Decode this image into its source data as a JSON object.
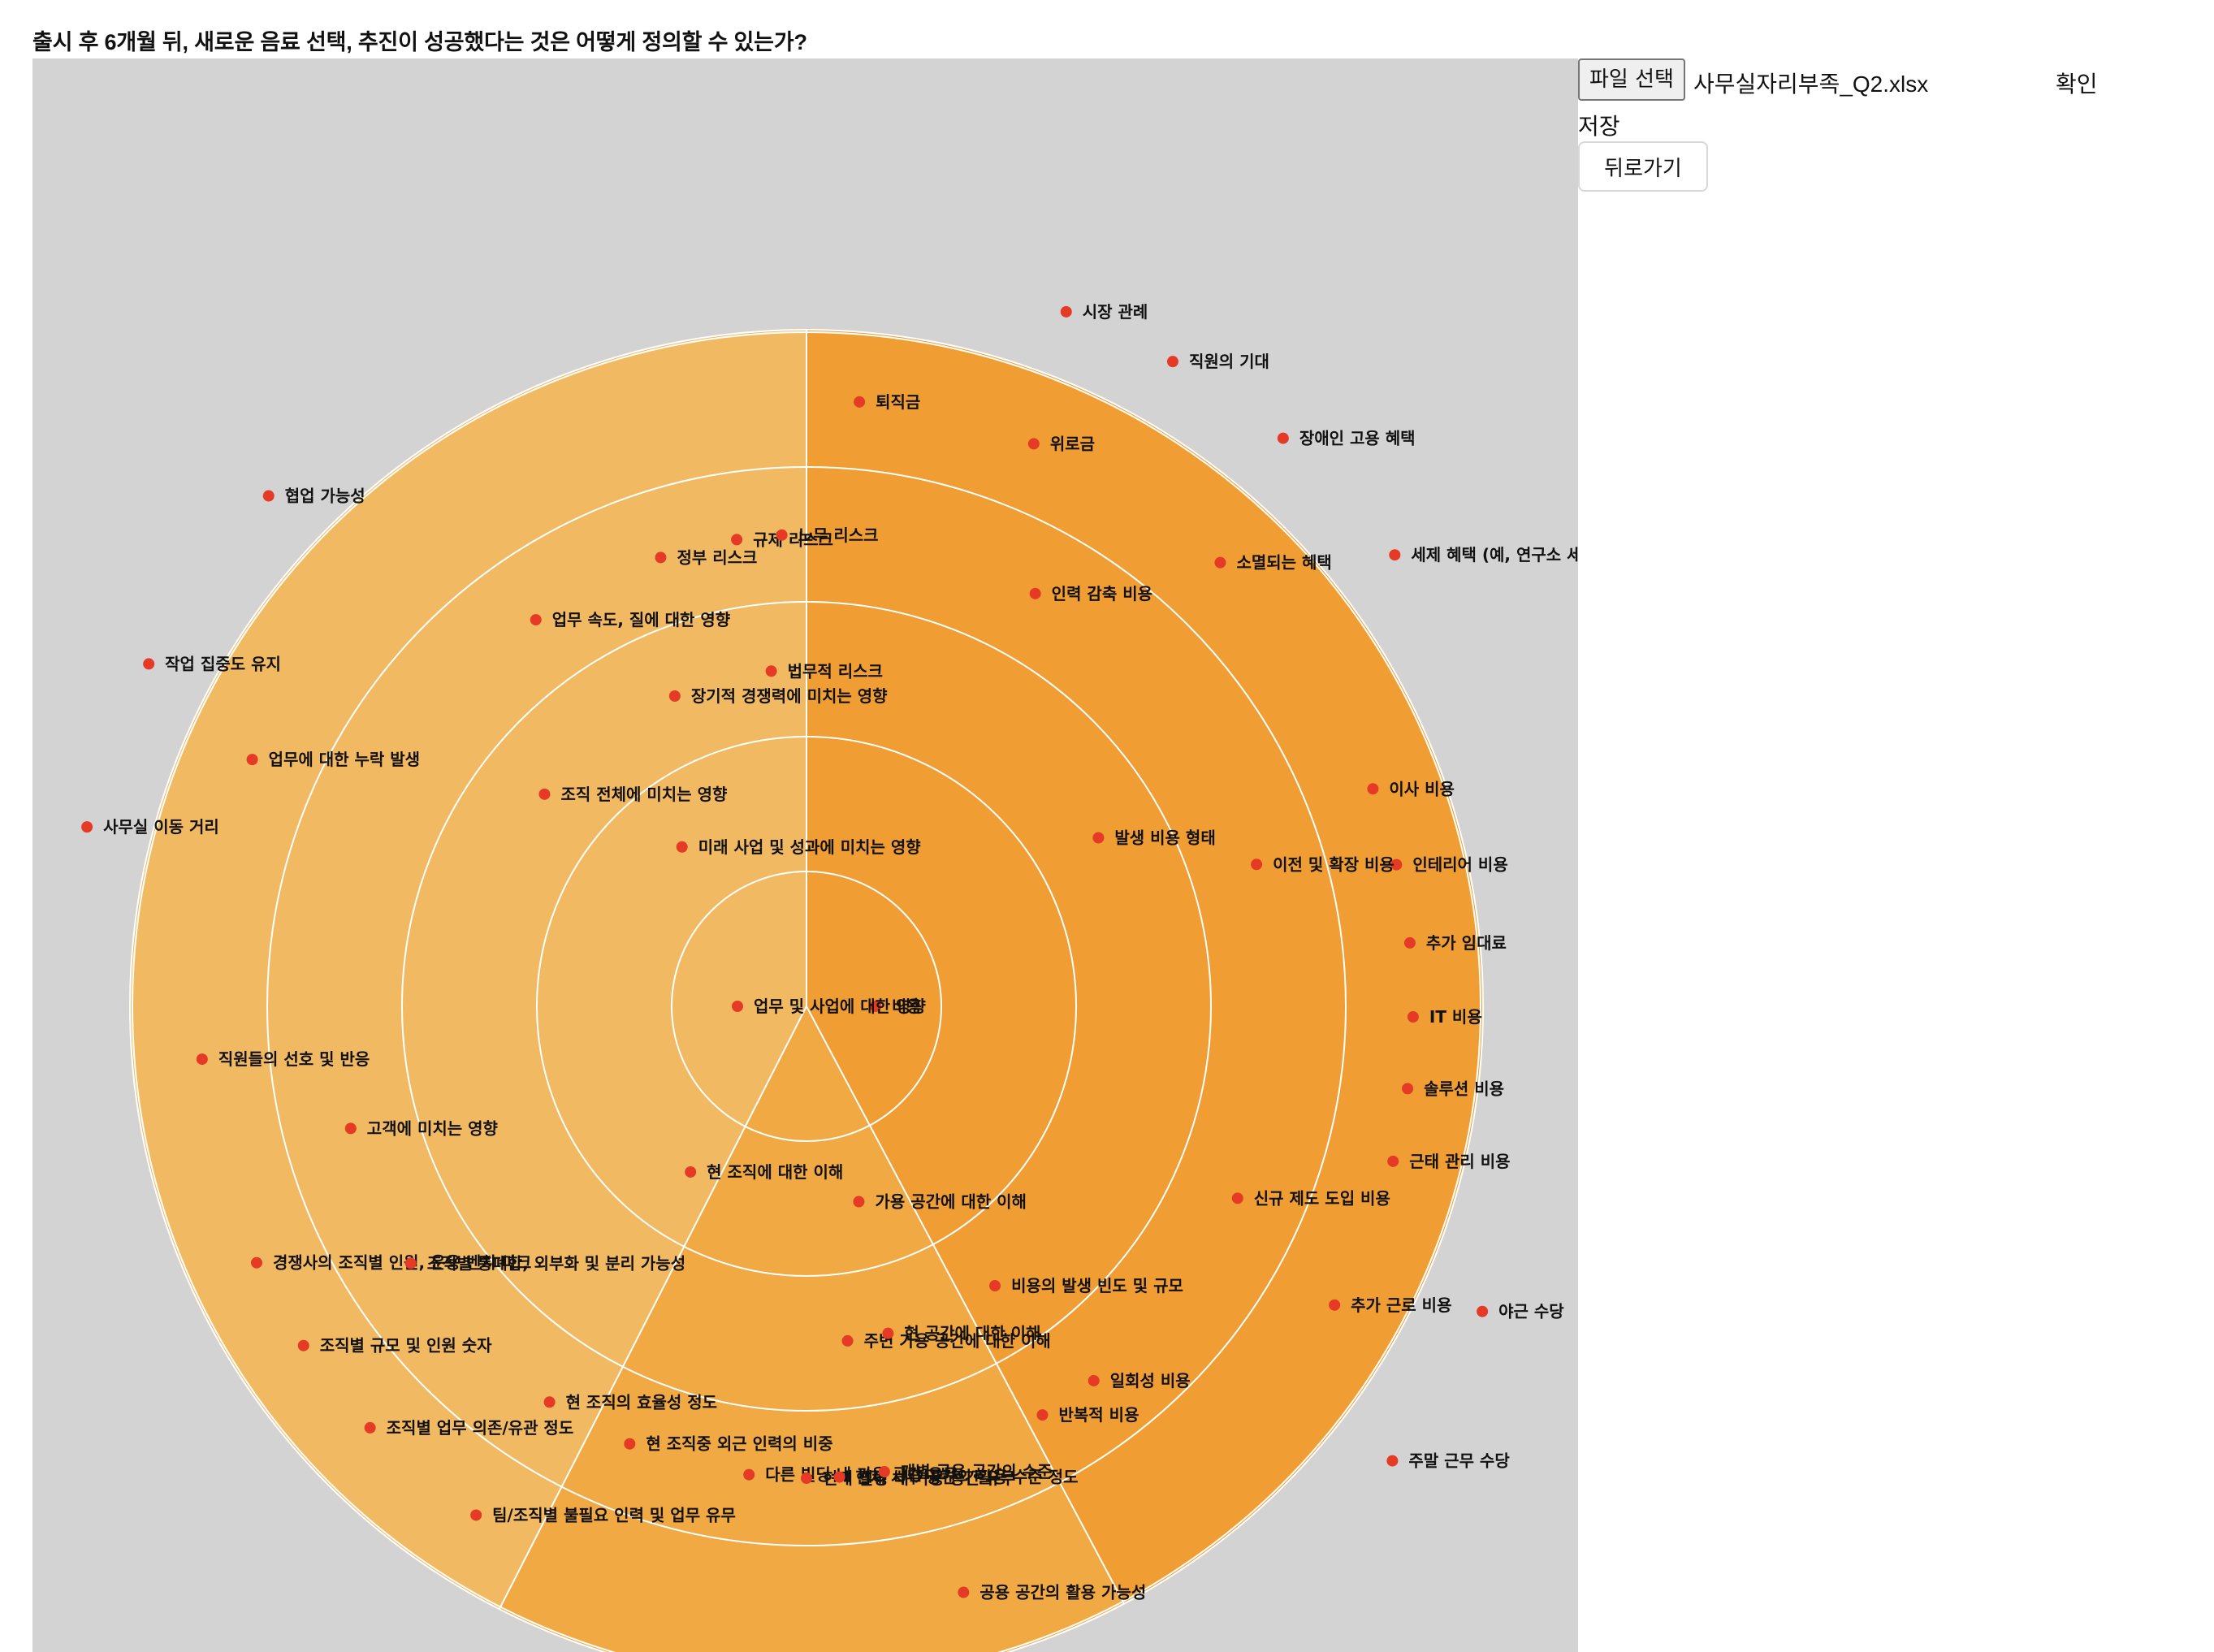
{
  "question": "출시 후 6개월 뒤, 새로운 음료 선택, 추진이 성공했다는 것은 어떻게 정의할 수 있는가?",
  "toolbar": {
    "file_button_label": "파일 선택",
    "file_name": "사무실자리부족_Q2.xlsx",
    "confirm_label": "확인",
    "save_label": "저장",
    "back_label": "뒤로가기"
  },
  "colors": {
    "canvas_bg": "#d3d3d3",
    "sector_left": "#f2b963",
    "sector_bottom": "#f1a944",
    "sector_right": "#f09d34",
    "ring_lines": "#ffffff",
    "dot": "#e53a25"
  },
  "nodes": [
    {
      "label": "시장 관례",
      "ring": 5,
      "angle": 20.5
    },
    {
      "label": "직원의 기대",
      "ring": 5,
      "angle": 29.6
    },
    {
      "label": "장애인 고용 혜택",
      "ring": 5,
      "angle": 40.0
    },
    {
      "label": "세제 혜택 (예, 연구소 세제 혜택)",
      "ring": 5,
      "angle": 52.5
    },
    {
      "label": "이사 비용",
      "ring": 4,
      "angle": 69.0
    },
    {
      "label": "인테리어 비용",
      "ring": 4,
      "angle": 76.5
    },
    {
      "label": "추가 임대료",
      "ring": 4,
      "angle": 84.0
    },
    {
      "label": "IT 비용",
      "ring": 4,
      "angle": 91.0
    },
    {
      "label": "솔루션 비용",
      "ring": 4,
      "angle": 97.8
    },
    {
      "label": "근태 관리 비용",
      "ring": 4,
      "angle": 104.8
    },
    {
      "label": "야근 수당",
      "ring": 5,
      "angle": 114.3
    },
    {
      "label": "추가 근로 비용",
      "ring": 4,
      "angle": 119.5
    },
    {
      "label": "주말 근무 수당",
      "ring": 5,
      "angle": 127.8
    },
    {
      "label": "퇴직금",
      "ring": 4,
      "angle": 5.0
    },
    {
      "label": "위로금",
      "ring": 4,
      "angle": 22.0
    },
    {
      "label": "소멸되는 혜택",
      "ring": 4,
      "angle": 43.0
    },
    {
      "label": "인력 감축 비용",
      "ring": 3,
      "angle": 29.0
    },
    {
      "label": "이전 및 확장 비용",
      "ring": 3,
      "angle": 72.5
    },
    {
      "label": "신규 제도 도입 비용",
      "ring": 3,
      "angle": 114.0
    },
    {
      "label": "발생 비용 형태",
      "ring": 2,
      "angle": 60.0
    },
    {
      "label": "비용의 발생 빈도 및 규모",
      "ring": 2,
      "angle": 146.0
    },
    {
      "label": "일회성 비용",
      "ring": 3,
      "angle": 142.5
    },
    {
      "label": "반복적 비용",
      "ring": 3,
      "angle": 150.0
    },
    {
      "label": "비용",
      "ring": 0,
      "angle": 90.0
    },
    {
      "label": "가용 공간에 대한 이해",
      "ring": 1,
      "angle": 165.0
    },
    {
      "label": "주변 가용 공간에 대한 이해",
      "ring": 2,
      "angle": 173.0
    },
    {
      "label": "현 공간에 대한 이해",
      "ring": 2,
      "angle": 166.0
    },
    {
      "label": "공용 공간의 활용 가능성",
      "ring": 4,
      "angle": 165.0
    },
    {
      "label": "다른 빌딩 내 가용 공간 유무",
      "ring": 3,
      "angle": 187.0
    },
    {
      "label": "현재 빌딩 내 가용 공간 유무",
      "ring": 3,
      "angle": 180.0
    },
    {
      "label": "현재 사무 공간의 활용 수준 정도",
      "ring": 3,
      "angle": 176.0
    },
    {
      "label": "개별 공용 공간의 수준",
      "ring": 3,
      "angle": 170.5
    },
    {
      "label": "업무 및 사업에 대한 영향",
      "ring": 0,
      "angle": 270.0
    },
    {
      "label": "미래 사업 및 성과에 미치는 영향",
      "ring": 1,
      "angle": 322.0
    },
    {
      "label": "조직 전체에 미치는 영향",
      "ring": 2,
      "angle": 309.0
    },
    {
      "label": "장기적 경쟁력에 미치는 영향",
      "ring": 2,
      "angle": 337.0
    },
    {
      "label": "법무적 리스크",
      "ring": 2,
      "angle": 354.0
    },
    {
      "label": "업무 속도, 질에 대한 영향",
      "ring": 3,
      "angle": 325.0
    },
    {
      "label": "규제 리스크",
      "ring": 3,
      "angle": 351.5
    },
    {
      "label": "노무 리스크",
      "ring": 3,
      "angle": 357.0
    },
    {
      "label": "정부 리스크",
      "ring": 3,
      "angle": 342.0
    },
    {
      "label": "협업 가능성",
      "ring": 5,
      "angle": 313.5
    },
    {
      "label": "작업 집중도 유지",
      "ring": 5,
      "angle": 297.5
    },
    {
      "label": "업무에 대한 누락 발생",
      "ring": 4,
      "angle": 294.0
    },
    {
      "label": "사무실 이동 거리",
      "ring": 5,
      "angle": 284.0
    },
    {
      "label": "직원들의 선호 및 반응",
      "ring": 4,
      "angle": 265.0
    },
    {
      "label": "고객에 미치는 영향",
      "ring": 3,
      "angle": 255.0
    },
    {
      "label": "현 조직에 대한 이해",
      "ring": 1,
      "angle": 215.0
    },
    {
      "label": "경쟁사의 조직별 인원, 운용 벤치 마크",
      "ring": 4,
      "angle": 245.0
    },
    {
      "label": "조직별 통폐합, 외부화 및 분리 가능성",
      "ring": 3,
      "angle": 237.0
    },
    {
      "label": "조직별 규모 및 인원 숫자",
      "ring": 4,
      "angle": 236.0
    },
    {
      "label": "현 조직의 효율성 정도",
      "ring": 3,
      "angle": 213.0
    },
    {
      "label": "조직별 업무 의존/유관 정도",
      "ring": 4,
      "angle": 226.0
    },
    {
      "label": "현 조직중 외근 인력의 비중",
      "ring": 3,
      "angle": 202.0
    },
    {
      "label": "팀/조직별 불필요 인력 및 업무 유무",
      "ring": 4,
      "angle": 213.0
    }
  ]
}
